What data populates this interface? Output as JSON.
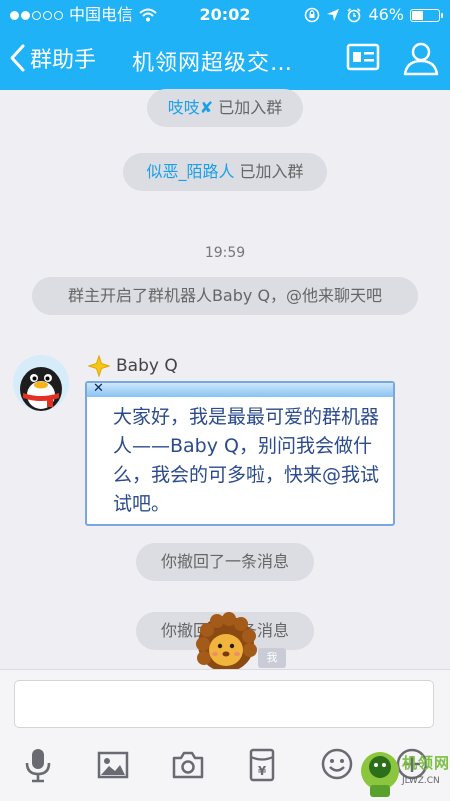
{
  "status_bar": {
    "carrier": "中国电信",
    "time": "20:02",
    "battery_text": "46%",
    "battery_level": 0.46
  },
  "nav": {
    "back_label": "群助手",
    "title": "机领网超级交…"
  },
  "messages": {
    "join1": {
      "name": "吱吱",
      "suffix": "已加入群"
    },
    "join2": {
      "name": "似恶_陌路人",
      "suffix": "已加入群"
    },
    "timestamp": "19:59",
    "system": "群主开启了群机器人Baby Q，@他来聊天吧",
    "bot": {
      "sender": "Baby Q",
      "text": "大家好，我是最最可爱的群机器人——Baby Q，别问我会做什么，我会的可多啦，快来@我试试吧。"
    },
    "recall1": "你撤回了一条消息",
    "recall2": "你撤回了一条消息",
    "me_tag": "我"
  },
  "watermark": {
    "text": "机领网",
    "url": "JLWZ.CN"
  },
  "colors": {
    "accent": "#1fb2f6",
    "link": "#1aa0e8",
    "bubble_text": "#2b4b8c"
  },
  "icons": [
    "back-chevron-icon",
    "profile-card-icon",
    "group-members-icon",
    "microphone-icon",
    "image-icon",
    "camera-icon",
    "red-packet-icon",
    "emoji-icon",
    "plus-icon"
  ]
}
